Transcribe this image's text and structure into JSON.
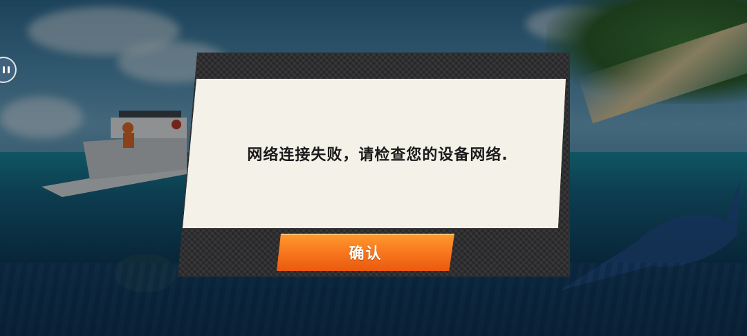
{
  "dialog": {
    "message": "网络连接失败，请检查您的设备网络.",
    "confirm_label": "确认"
  },
  "hud": {
    "pause_icon": "pause-icon"
  },
  "colors": {
    "dialog_frame": "#2a2a2c",
    "dialog_body": "#f3f1e8",
    "confirm_button": "#f7741c",
    "message_text": "#1a1a1a"
  }
}
